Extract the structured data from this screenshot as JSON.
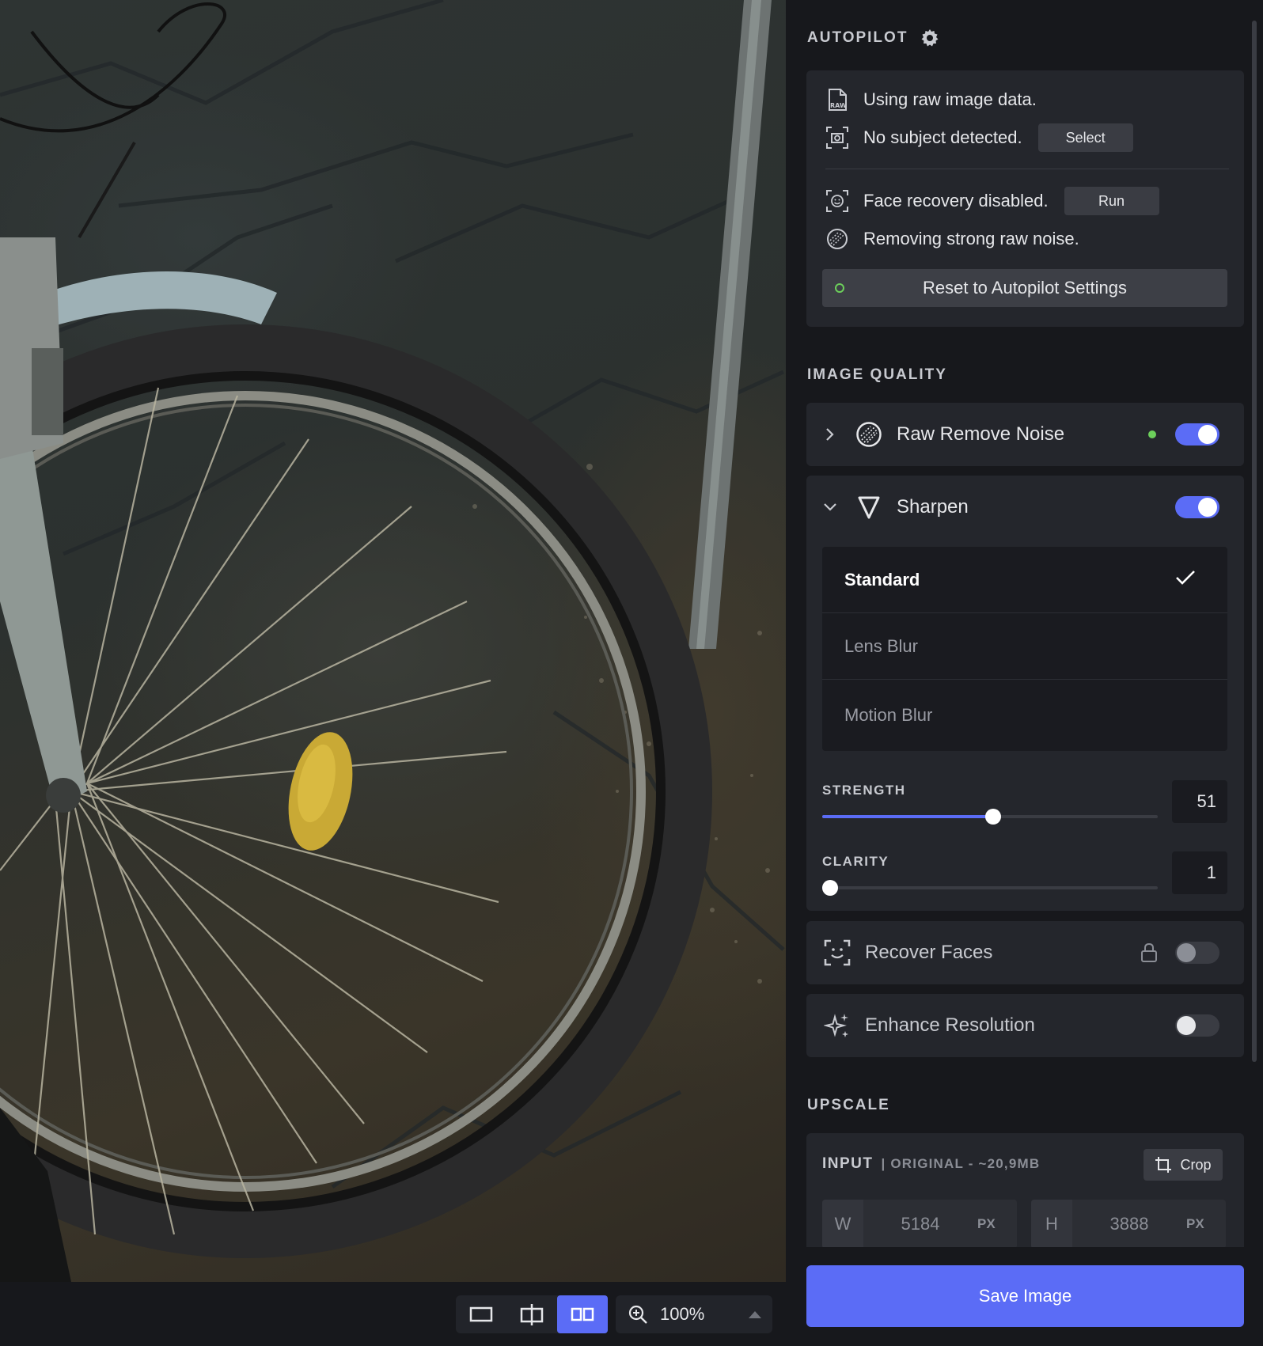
{
  "autopilot": {
    "title": "AUTOPILOT",
    "messages": [
      {
        "text": "Using raw image data.",
        "icon": "raw-file-icon"
      },
      {
        "text": "No subject detected.",
        "icon": "subject-camera-icon",
        "button": "Select"
      },
      {
        "text": "Face recovery disabled.",
        "icon": "face-scan-icon",
        "button": "Run"
      },
      {
        "text": "Removing strong raw noise.",
        "icon": "noise-icon"
      }
    ],
    "reset_label": "Reset to Autopilot Settings"
  },
  "image_quality": {
    "title": "IMAGE QUALITY",
    "raw_remove_noise": {
      "label": "Raw Remove Noise",
      "enabled": true
    },
    "sharpen": {
      "label": "Sharpen",
      "enabled": true,
      "modes": [
        "Standard",
        "Lens Blur",
        "Motion Blur"
      ],
      "selected_mode": "Standard",
      "strength": {
        "label": "STRENGTH",
        "value": "51",
        "fraction": 0.51
      },
      "clarity": {
        "label": "CLARITY",
        "value": "1",
        "fraction": 0.01
      }
    },
    "recover_faces": {
      "label": "Recover Faces",
      "enabled": false,
      "locked": true
    },
    "enhance_resolution": {
      "label": "Enhance Resolution",
      "enabled": false
    }
  },
  "upscale": {
    "title": "UPSCALE",
    "input_label": "INPUT",
    "input_info": "| ORIGINAL - ~20,9MB",
    "crop_label": "Crop",
    "width": {
      "axis": "W",
      "value": "5184",
      "unit": "PX"
    },
    "height": {
      "axis": "H",
      "value": "3888",
      "unit": "PX"
    }
  },
  "save_label": "Save Image",
  "toolbar": {
    "zoom": "100%",
    "active_view": "side-by-side"
  },
  "colors": {
    "accent": "#5b6cf6",
    "active_dot": "#6ccf5b",
    "panel_bg": "#17181c",
    "card_bg": "#24262c"
  }
}
